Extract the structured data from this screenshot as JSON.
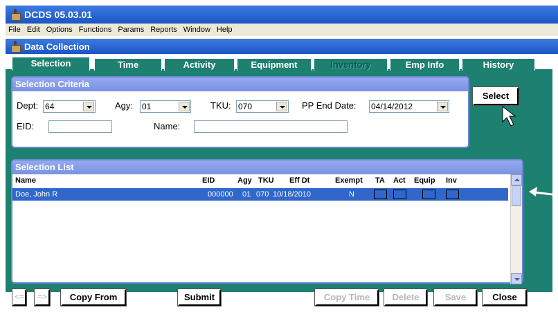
{
  "window": {
    "title": "DCDS 05.03.01"
  },
  "menu": [
    "File",
    "Edit",
    "Options",
    "Functions",
    "Params",
    "Reports",
    "Window",
    "Help"
  ],
  "form": {
    "title": "Data Collection"
  },
  "tabs": [
    {
      "label": "Selection",
      "state": "active"
    },
    {
      "label": "Time",
      "state": "normal"
    },
    {
      "label": "Activity",
      "state": "normal"
    },
    {
      "label": "Equipment",
      "state": "normal"
    },
    {
      "label": "Inventory",
      "state": "disabled"
    },
    {
      "label": "Emp Info",
      "state": "normal"
    },
    {
      "label": "History",
      "state": "normal"
    }
  ],
  "criteria": {
    "title": "Selection Criteria",
    "dept_label": "Dept:",
    "dept_value": "64",
    "agy_label": "Agy:",
    "agy_value": "01",
    "tku_label": "TKU:",
    "tku_value": "070",
    "pp_end_label": "PP End Date:",
    "pp_end_value": "04/14/2012",
    "eid_label": "EID:",
    "eid_value": "",
    "name_label": "Name:",
    "name_value": ""
  },
  "select_button": "Select",
  "list": {
    "title": "Selection List",
    "columns": [
      "Name",
      "EID",
      "Agy",
      "TKU",
      "Eff Dt",
      "Exempt",
      "TA",
      "Act",
      "Equip",
      "Inv"
    ],
    "rows": [
      {
        "name": "Doe, John R",
        "eid": "000000",
        "agy": "01",
        "tku": "070",
        "eff_dt": "10/18/2010",
        "exempt": "N"
      }
    ]
  },
  "footer": {
    "prev": "<=",
    "next": "=>",
    "copy_from": "Copy From",
    "submit": "Submit",
    "copy_time": "Copy Time",
    "delete": "Delete",
    "save": "Save",
    "close": "Close"
  },
  "colors": {
    "panel": "#1d8070",
    "titlebar": "#1a55c4",
    "selection": "#3166cb",
    "group_head": "#7a92e2"
  }
}
